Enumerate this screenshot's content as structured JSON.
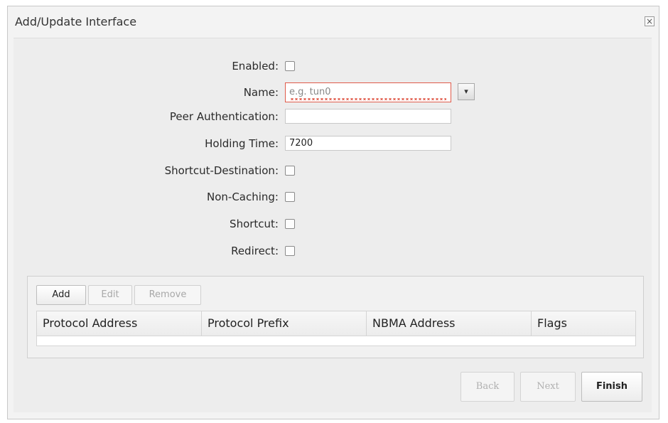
{
  "dialog": {
    "title": "Add/Update Interface",
    "close_glyph": "×"
  },
  "form": {
    "enabled_label": "Enabled:",
    "name_label": "Name:",
    "name_placeholder": "e.g. tun0",
    "name_value": "",
    "peer_auth_label": "Peer Authentication:",
    "peer_auth_value": "",
    "holding_time_label": "Holding Time:",
    "holding_time_value": "7200",
    "shortcut_destination_label": "Shortcut-Destination:",
    "non_caching_label": "Non-Caching:",
    "shortcut_label": "Shortcut:",
    "redirect_label": "Redirect:"
  },
  "grid": {
    "toolbar": {
      "add_label": "Add",
      "edit_label": "Edit",
      "remove_label": "Remove"
    },
    "columns": [
      "Protocol Address",
      "Protocol Prefix",
      "NBMA Address",
      "Flags"
    ],
    "rows": []
  },
  "footer": {
    "back_label": "Back",
    "next_label": "Next",
    "finish_label": "Finish"
  },
  "icons": {
    "dropdown": "chevron-down-icon",
    "close": "close-icon"
  },
  "colors": {
    "invalid_border": "#e05a4a"
  }
}
